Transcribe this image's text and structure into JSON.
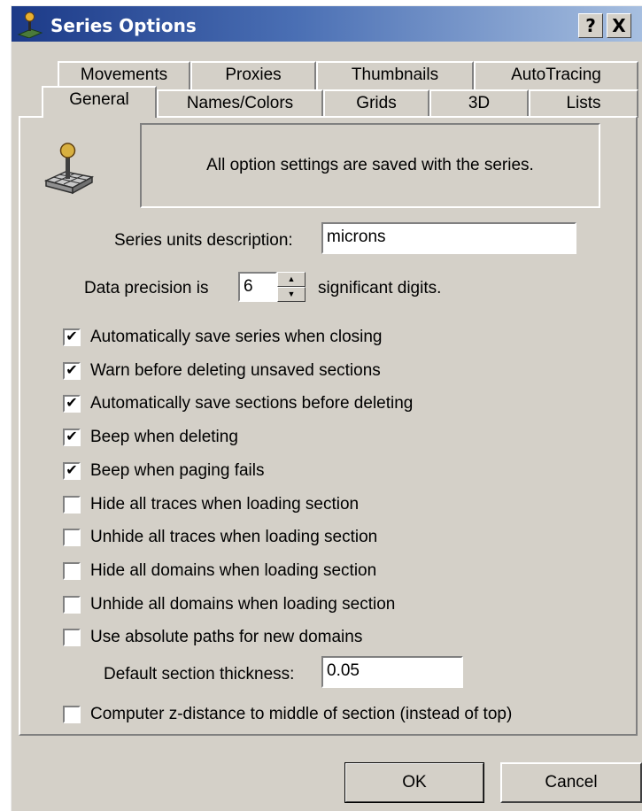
{
  "window": {
    "title": "Series Options",
    "help_label": "?",
    "close_label": "X"
  },
  "tabs_row1": [
    "Movements",
    "Proxies",
    "Thumbnails",
    "AutoTracing"
  ],
  "tabs_row2": [
    "General",
    "Names/Colors",
    "Grids",
    "3D",
    "Lists"
  ],
  "active_tab": "General",
  "info_text": "All option settings are saved with the series.",
  "units": {
    "label": "Series units description:",
    "value": "microns"
  },
  "precision": {
    "prefix": "Data precision is",
    "value": "6",
    "suffix": "significant digits."
  },
  "checkboxes": [
    {
      "label": "Automatically save series when closing",
      "checked": true
    },
    {
      "label": "Warn before deleting unsaved sections",
      "checked": true
    },
    {
      "label": "Automatically save sections before deleting",
      "checked": true
    },
    {
      "label": "Beep when deleting",
      "checked": true
    },
    {
      "label": "Beep when paging fails",
      "checked": true
    },
    {
      "label": "Hide all traces when loading section",
      "checked": false
    },
    {
      "label": "Unhide all traces when loading section",
      "checked": false
    },
    {
      "label": "Hide all domains when loading section",
      "checked": false
    },
    {
      "label": "Unhide all domains when loading section",
      "checked": false
    },
    {
      "label": "Use absolute paths for new domains",
      "checked": false
    }
  ],
  "thickness": {
    "label": "Default section thickness:",
    "value": "0.05"
  },
  "zdistance": {
    "label": "Computer z-distance to middle of section (instead of top)",
    "checked": false
  },
  "buttons": {
    "ok": "OK",
    "cancel": "Cancel"
  }
}
